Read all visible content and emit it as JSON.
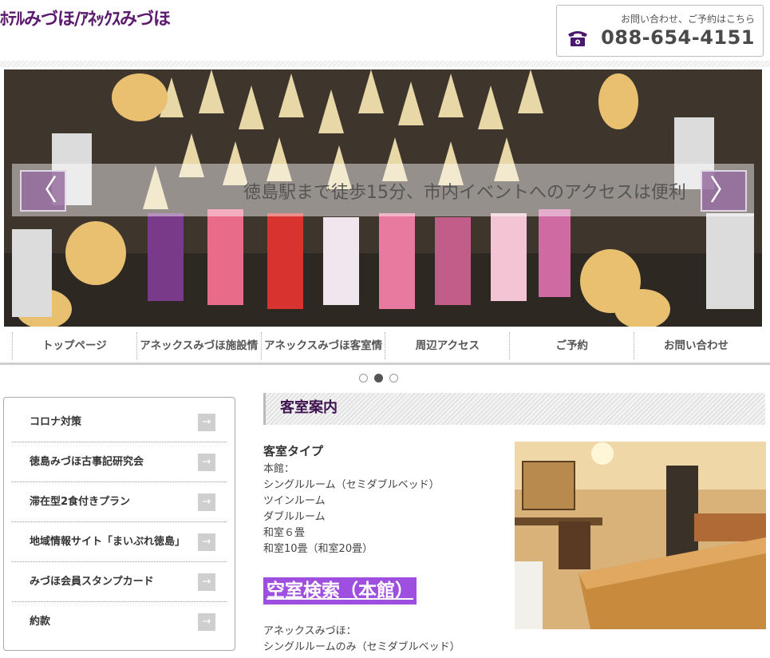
{
  "header": {
    "logo_text": "ﾎﾃﾙみづほ/ｱﾈｯｸｽみづほ",
    "contact_caption": "お問い合わせ、ご予約はこちら",
    "phone_number": "088-654-4151"
  },
  "hero": {
    "caption": "徳島駅まで徒歩15分、市内イベントへのアクセスは便利",
    "prev_arrow": "〈",
    "next_arrow": "〉"
  },
  "nav": {
    "items": [
      "トップページ",
      "アネックスみづほ施設情",
      "アネックスみづほ客室情",
      "周辺アクセス",
      "ご予約",
      "お問い合わせ"
    ]
  },
  "carousel": {
    "slide_count": 3,
    "active_index": 1
  },
  "sidebar": {
    "items": [
      {
        "label": "コロナ対策",
        "arrow": "→"
      },
      {
        "label": "徳島みづほ古事記研究会",
        "arrow": "→"
      },
      {
        "label": "滞在型2食付きプラン",
        "arrow": "→"
      },
      {
        "label": "地域情報サイト「まいぷれ徳島」",
        "arrow": "→"
      },
      {
        "label": "みづほ会員スタンプカード",
        "arrow": "→"
      },
      {
        "label": "約款",
        "arrow": "→"
      }
    ]
  },
  "main": {
    "section_title": "客室案内",
    "room_heading": "客室タイプ",
    "honkan_lines": [
      "本館：",
      "シングルルーム（セミダブルベッド）",
      "ツインルーム",
      "ダブルルーム",
      "和室６畳",
      "和室10畳（和室20畳）"
    ],
    "search_link": "空室検索（本館）",
    "annex_lines": [
      "アネックスみづほ：",
      "シングルルームのみ（セミダブルベッド）"
    ]
  },
  "colors": {
    "brand_purple": "#5a1a6e",
    "search_bg": "#9f4fe0",
    "arrow_btn": "#966ea0"
  }
}
